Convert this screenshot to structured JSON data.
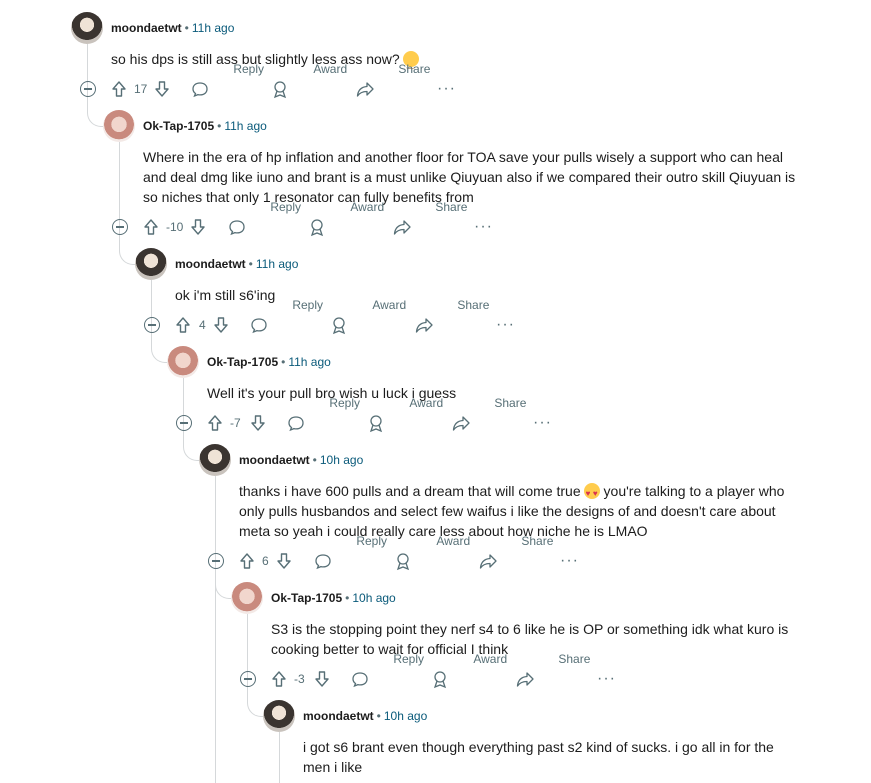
{
  "comments": [
    {
      "username": "moondaetwt",
      "time": "11h ago",
      "avatar": "dark-hair-avatar",
      "body": "so his dps is still ass but slightly less ass now?",
      "emoji": "relieved-face",
      "votes": "17",
      "reply": "Reply",
      "award": "Award",
      "share": "Share"
    },
    {
      "username": "Ok-Tap-1705",
      "time": "11h ago",
      "avatar": "pink-avatar",
      "body": "Where in the era of hp inflation and another floor for TOA save your pulls wisely a support who can heal and deal dmg like iuno and brant is a must unlike Qiuyuan also if we compared their outro skill Qiuyuan is so niches that only 1 resonator can fully benefits from",
      "votes": "-10",
      "reply": "Reply",
      "award": "Award",
      "share": "Share"
    },
    {
      "username": "moondaetwt",
      "time": "11h ago",
      "avatar": "dark-hair-avatar",
      "body": "ok i'm still s6'ing",
      "votes": "4",
      "reply": "Reply",
      "award": "Award",
      "share": "Share"
    },
    {
      "username": "Ok-Tap-1705",
      "time": "11h ago",
      "avatar": "pink-avatar",
      "body": "Well it's your pull bro wish u luck i guess",
      "votes": "-7",
      "reply": "Reply",
      "award": "Award",
      "share": "Share"
    },
    {
      "username": "moondaetwt",
      "time": "10h ago",
      "avatar": "dark-hair-avatar",
      "body_before": "thanks i have 600 pulls and a dream that will come true",
      "emoji": "heart-eyes-face",
      "body_after": "you're talking to a player who only pulls husbandos and select few waifus i like the designs of and doesn't care about meta so yeah i could really care less about how niche he is LMAO",
      "votes": "6",
      "reply": "Reply",
      "award": "Award",
      "share": "Share"
    },
    {
      "username": "Ok-Tap-1705",
      "time": "10h ago",
      "avatar": "pink-avatar",
      "body": "S3 is the stopping point they nerf s4 to 6 like he is OP or something idk what kuro is cooking better to wait for official I think",
      "votes": "-3",
      "reply": "Reply",
      "award": "Award",
      "share": "Share"
    },
    {
      "username": "moondaetwt",
      "time": "10h ago",
      "avatar": "dark-hair-avatar",
      "body": "i got s6 brant even though everything past s2 kind of sucks. i go all in for the men i like"
    }
  ],
  "separator": "•",
  "colors": {
    "username": "#1c1c1c",
    "timestamp": "#0a5a7a",
    "actions": "#576f76",
    "thread_line": "#d5d8da",
    "heart_emoji": "#ffcc4d"
  }
}
